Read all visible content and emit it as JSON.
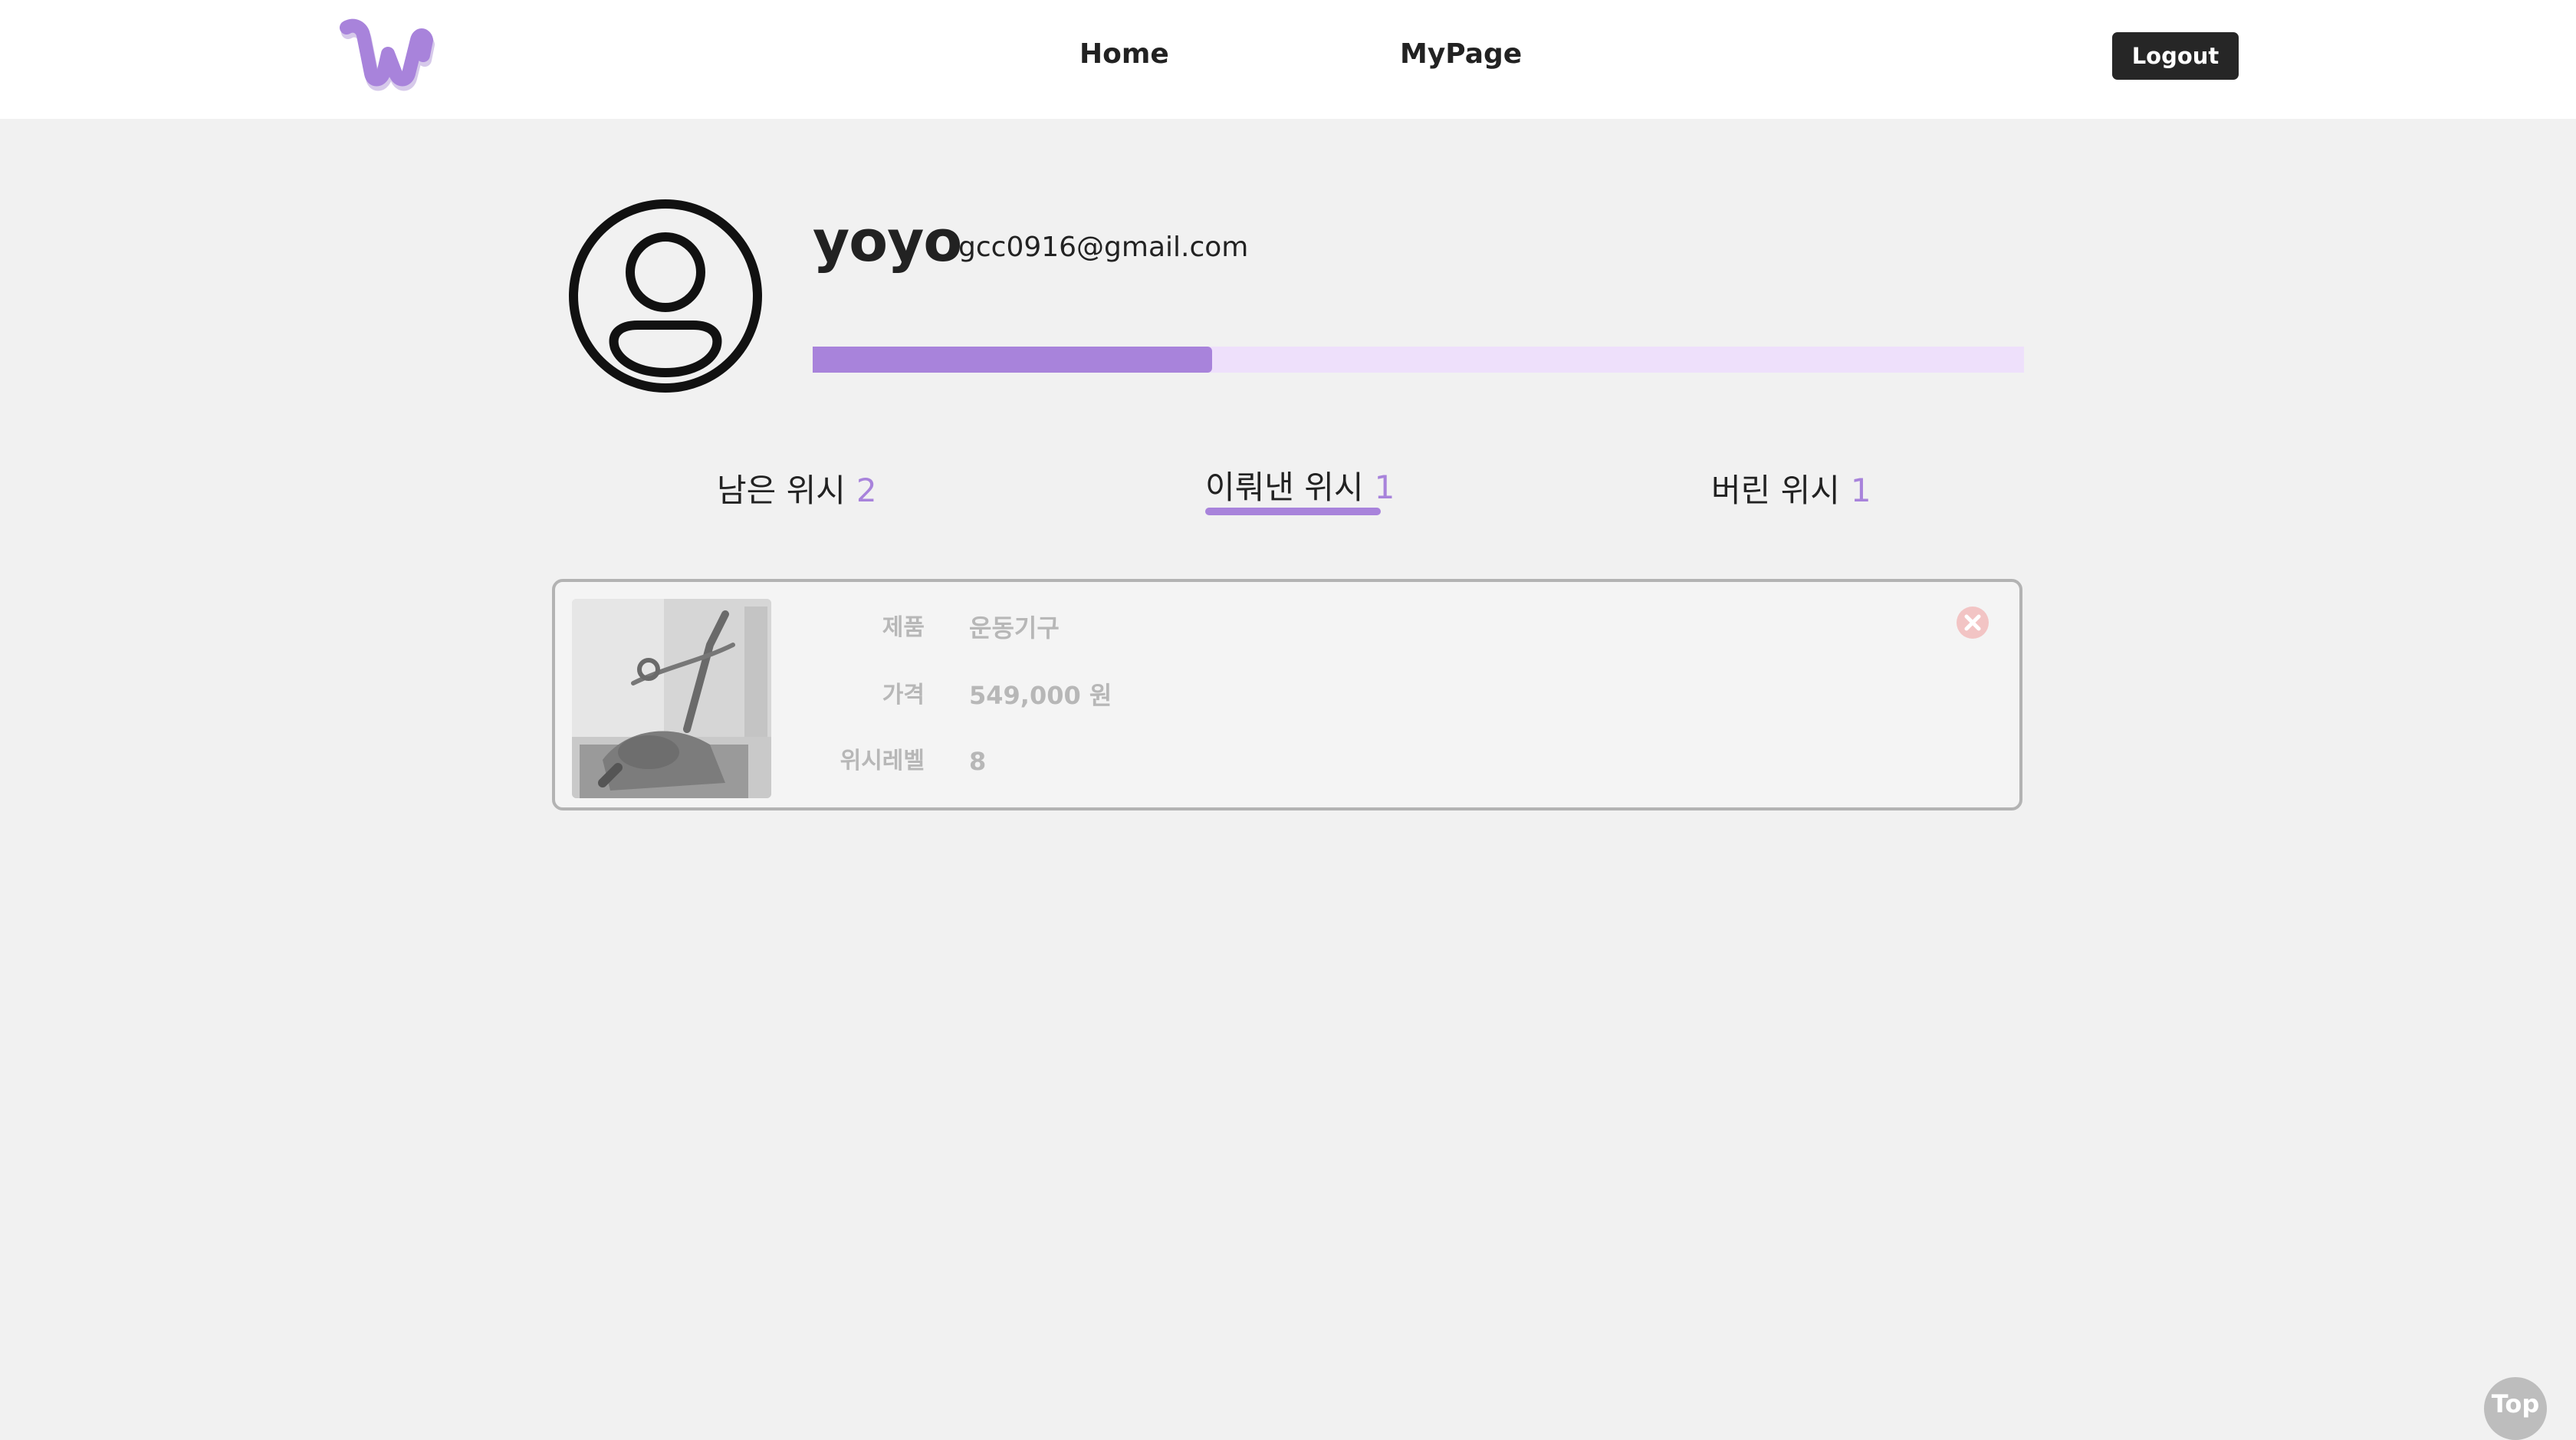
{
  "header": {
    "logo_icon": "wishlist-logo-w",
    "nav": {
      "home_label": "Home",
      "mypage_label": "MyPage"
    },
    "logout_label": "Logout"
  },
  "profile": {
    "avatar_icon": "user-circle-icon",
    "username": "yoyo",
    "email": "gcc0916@gmail.com",
    "progress": 0.33
  },
  "tabs": [
    {
      "label": "남은 위시",
      "count": "2",
      "active": false
    },
    {
      "label": "이뤄낸 위시",
      "count": "1",
      "active": true
    },
    {
      "label": "버린 위시",
      "count": "1",
      "active": false
    }
  ],
  "wish_items": [
    {
      "image_icon": "exercise-equipment-photo",
      "product_label": "제품",
      "product_value": "운동기구",
      "price_label": "가격",
      "price_value": "549,000 원",
      "level_label": "위시레벨",
      "level_value": "8",
      "remove_icon": "close-circle-icon"
    }
  ],
  "top_button_label": "Top",
  "colors": {
    "accent": "#a883db",
    "accent_light": "#eee0fb",
    "background": "#f1f1f1",
    "header_bg": "#ffffff",
    "button_dark": "#262626",
    "remove_icon": "#f2c4c4"
  }
}
